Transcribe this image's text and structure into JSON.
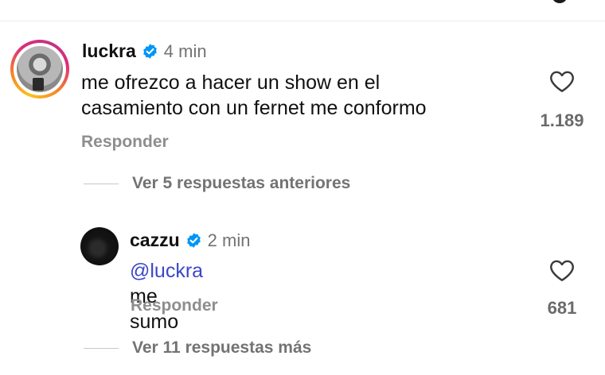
{
  "comments": [
    {
      "username": "luckra",
      "time": "4 min",
      "text_line1": "me ofrezco a hacer un show en el",
      "text_line2": "casamiento con un fernet me conformo",
      "likes": "1.189",
      "reply_label": "Responder",
      "avatar_icon": "profile-photo-story-ring",
      "verified_icon": "verified-badge-icon"
    },
    {
      "username": "cazzu",
      "time": "2 min",
      "mention": "@luckra",
      "text": " me sumo",
      "likes": "681",
      "reply_label": "Responder",
      "avatar_icon": "profile-photo",
      "verified_icon": "verified-badge-icon"
    }
  ],
  "threads": {
    "previous_replies": "Ver 5 respuestas anteriores",
    "more_replies": "Ver 11 respuestas más"
  },
  "colors": {
    "verified_blue": "#0095f6",
    "mention_blue": "#3b47c8",
    "muted_gray": "#737373"
  }
}
